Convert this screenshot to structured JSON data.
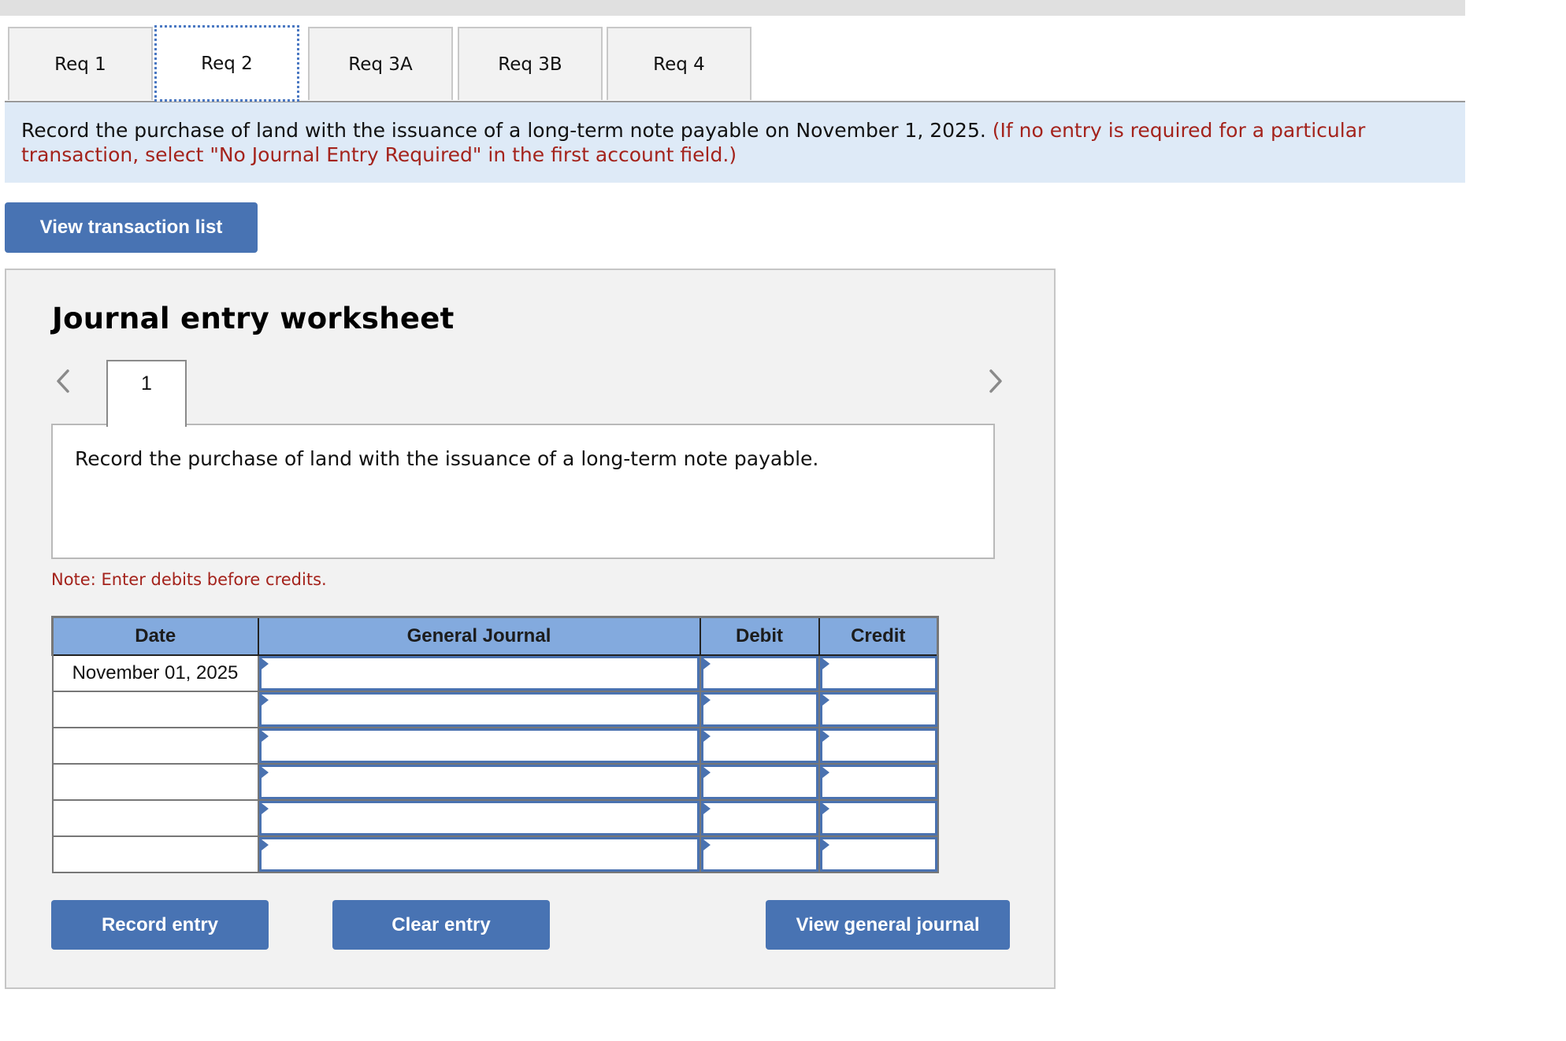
{
  "tabs": [
    {
      "label": "Req 1",
      "active": false
    },
    {
      "label": "Req 2",
      "active": true
    },
    {
      "label": "Req 3A",
      "active": false
    },
    {
      "label": "Req 3B",
      "active": false
    },
    {
      "label": "Req 4",
      "active": false
    }
  ],
  "instructions": {
    "main": "Record the purchase of land with the issuance of a long-term note payable on November 1, 2025.",
    "hint": "(If no entry is required for a particular transaction, select \"No Journal Entry Required\" in the first account field.)"
  },
  "view_transaction_list_label": "View transaction list",
  "worksheet": {
    "title": "Journal entry worksheet",
    "entry_tab": "1",
    "prev_icon": "chevron-left-icon",
    "next_icon": "chevron-right-icon",
    "description": "Record the purchase of land with the issuance of a long-term note payable.",
    "note": "Note: Enter debits before credits.",
    "table": {
      "headers": [
        "Date",
        "General Journal",
        "Debit",
        "Credit"
      ],
      "rows": [
        {
          "date": "November 01, 2025",
          "account": "",
          "debit": "",
          "credit": ""
        },
        {
          "date": "",
          "account": "",
          "debit": "",
          "credit": ""
        },
        {
          "date": "",
          "account": "",
          "debit": "",
          "credit": ""
        },
        {
          "date": "",
          "account": "",
          "debit": "",
          "credit": ""
        },
        {
          "date": "",
          "account": "",
          "debit": "",
          "credit": ""
        },
        {
          "date": "",
          "account": "",
          "debit": "",
          "credit": ""
        }
      ]
    },
    "buttons": {
      "record": "Record entry",
      "clear": "Clear entry",
      "view_general_journal": "View general journal"
    }
  },
  "colors": {
    "accent_button": "#4873b3",
    "table_header": "#83aade",
    "banner_bg": "#deeaf7",
    "hint_red": "#a4231c"
  }
}
